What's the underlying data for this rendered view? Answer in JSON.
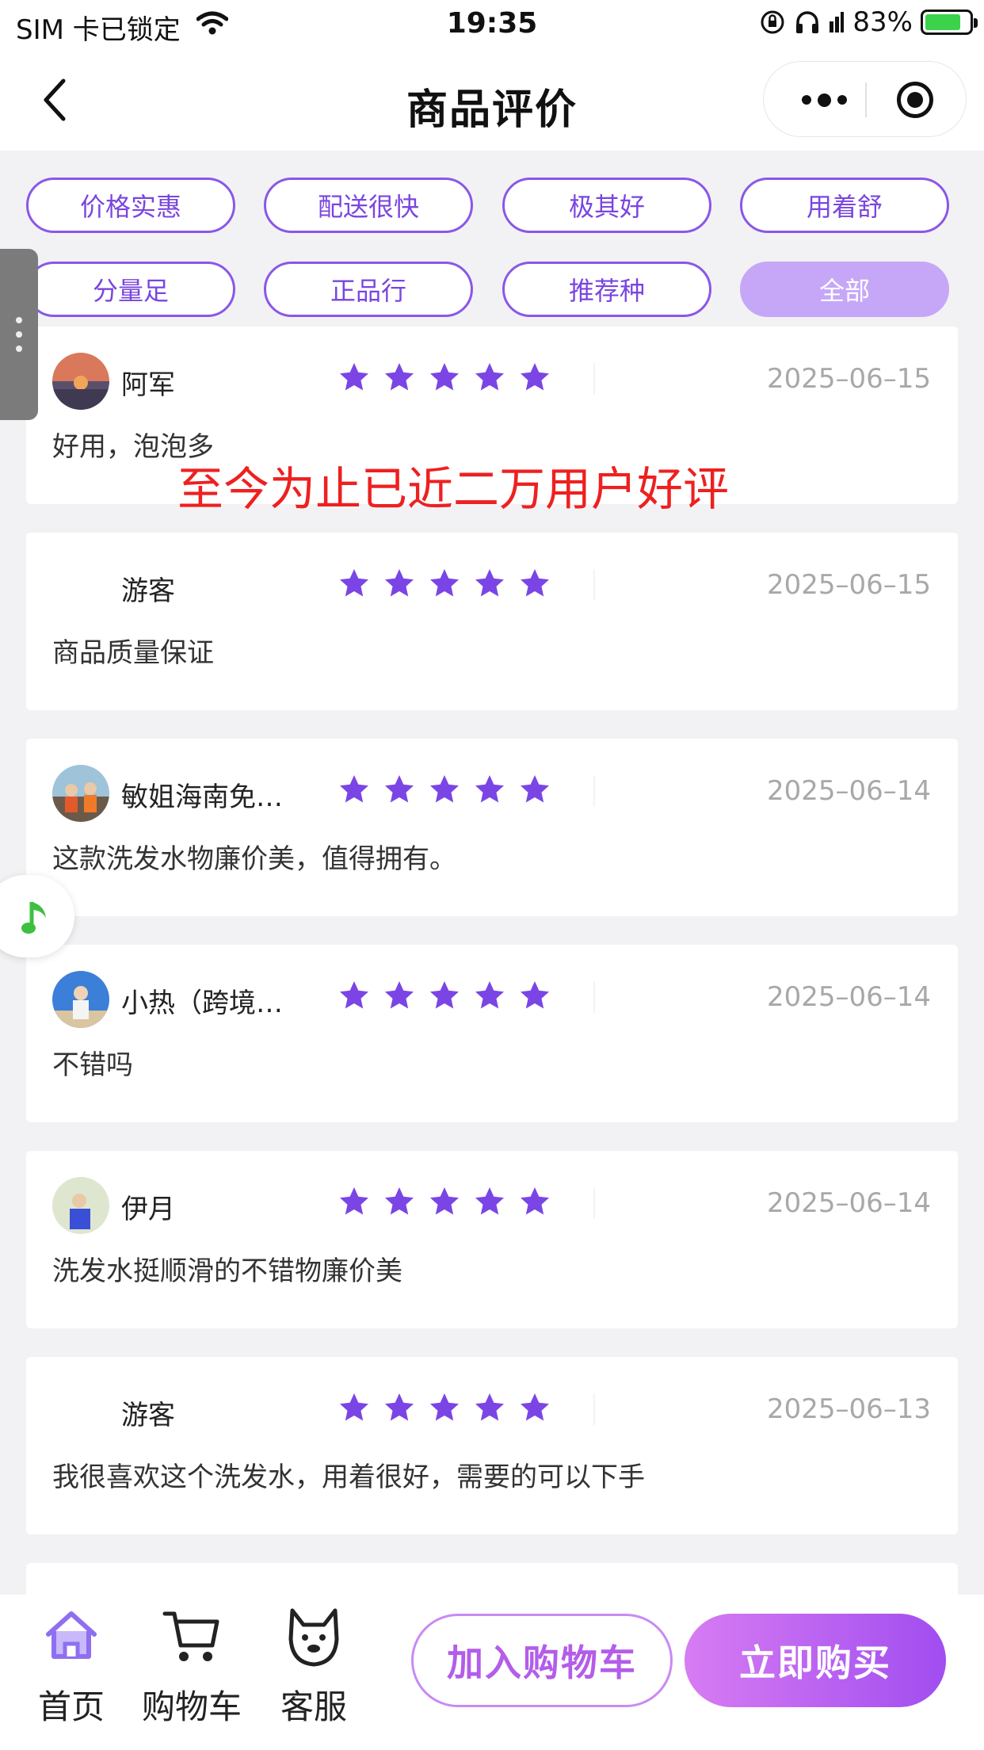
{
  "status_bar": {
    "carrier": "SIM 卡已锁定",
    "time": "19:35",
    "battery": "83%"
  },
  "nav": {
    "title": "商品评价"
  },
  "tags": [
    {
      "label": "价格实惠",
      "active": false
    },
    {
      "label": "配送很快",
      "active": false
    },
    {
      "label": "极其好",
      "active": false
    },
    {
      "label": "用着舒",
      "active": false
    },
    {
      "label": "分量足",
      "active": false
    },
    {
      "label": "正品行",
      "active": false
    },
    {
      "label": "推荐种",
      "active": false
    },
    {
      "label": "全部",
      "active": true
    }
  ],
  "overlay_text": "至今为止已近二万用户好评",
  "reviews": [
    {
      "name": "阿军",
      "rating": 5,
      "date": "2025–06–15",
      "comment": "好用，泡泡多",
      "avatar": "sunset-photo"
    },
    {
      "name": "游客",
      "rating": 5,
      "date": "2025–06–15",
      "comment": "商品质量保证",
      "avatar": "none"
    },
    {
      "name": "敏姐海南免…",
      "rating": 5,
      "date": "2025–06–14",
      "comment": "这款洗发水物廉价美，值得拥有。",
      "avatar": "group-photo"
    },
    {
      "name": "小热（跨境…",
      "rating": 5,
      "date": "2025–06–14",
      "comment": "不错吗",
      "avatar": "person-sky-photo"
    },
    {
      "name": "伊月",
      "rating": 5,
      "date": "2025–06–14",
      "comment": "洗发水挺顺滑的不错物廉价美",
      "avatar": "person-blue-photo"
    },
    {
      "name": "游客",
      "rating": 5,
      "date": "2025–06–13",
      "comment": "我很喜欢这个洗发水，用着很好，需要的可以下手",
      "avatar": "none"
    }
  ],
  "bottom_bar": {
    "home_label": "首页",
    "cart_label": "购物车",
    "service_label": "客服",
    "add_cart_label": "加入购物车",
    "buy_now_label": "立即购买"
  },
  "colors": {
    "accent": "#7b45e6",
    "star": "#7b45e6",
    "tag_active_bg": "#c6a7f7",
    "overlay_red": "#ee2020"
  }
}
